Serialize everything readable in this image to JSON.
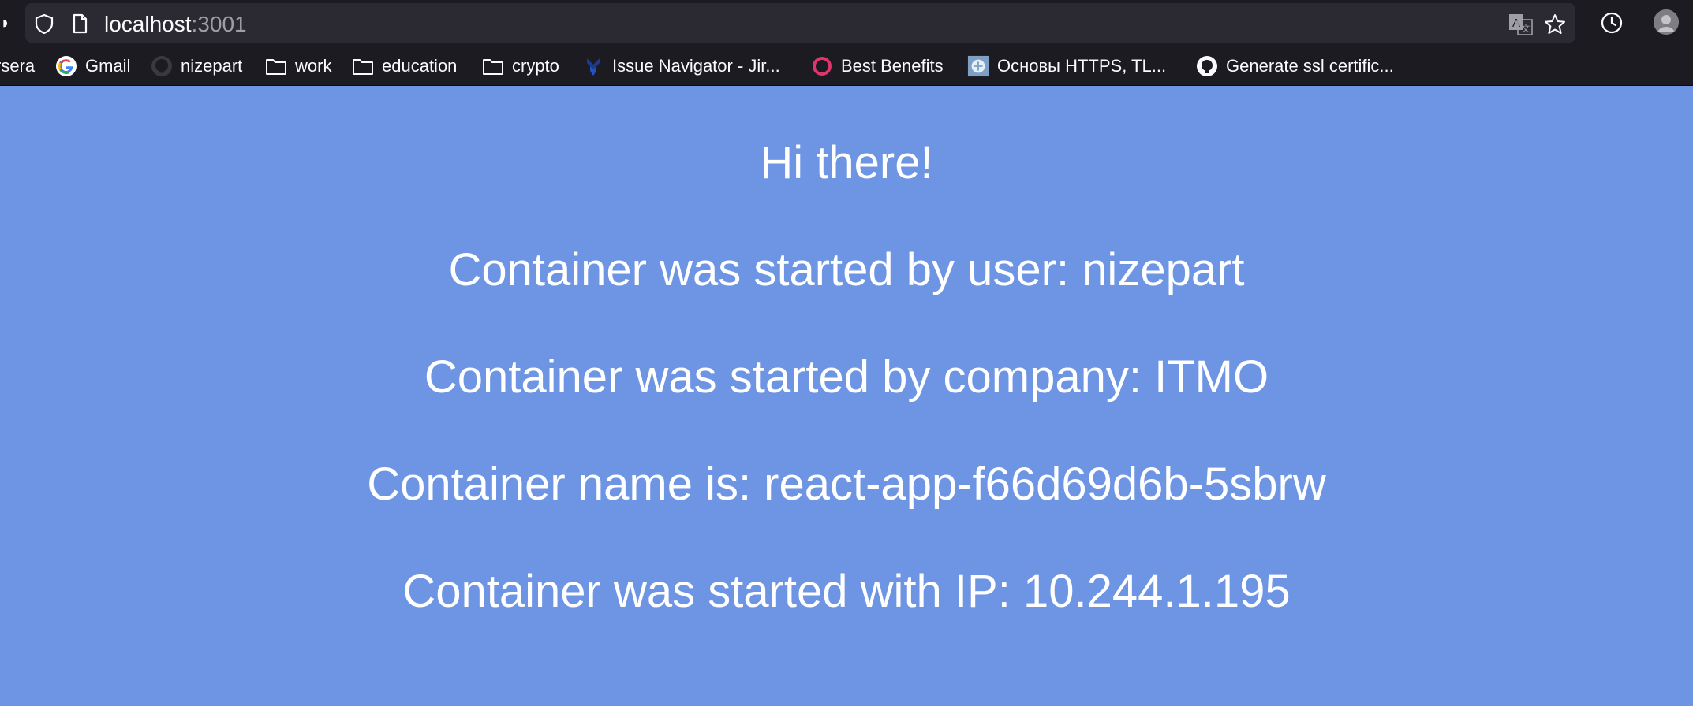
{
  "browser": {
    "url_host": "localhost",
    "url_port": ":3001",
    "left_edge_glyph": "◗"
  },
  "bookmarks": [
    {
      "label": "rsera",
      "icon": "none"
    },
    {
      "label": "Gmail",
      "icon": "google-icon"
    },
    {
      "label": "nizepart",
      "icon": "github-icon"
    },
    {
      "label": "work",
      "icon": "folder-icon"
    },
    {
      "label": "education",
      "icon": "folder-icon"
    },
    {
      "label": "crypto",
      "icon": "folder-icon"
    },
    {
      "label": "Issue Navigator - Jir...",
      "icon": "jira-icon"
    },
    {
      "label": "Best Benefits",
      "icon": "benefits-icon"
    },
    {
      "label": "Основы HTTPS, TL...",
      "icon": "site-icon"
    },
    {
      "label": "Generate ssl certific...",
      "icon": "github-icon"
    }
  ],
  "content": {
    "greeting": "Hi there!",
    "user_line": "Container was started by user: nizepart",
    "company_line": "Container was started by company: ITMO",
    "name_line": "Container name is: react-app-f66d69d6b-5sbrw",
    "ip_line": "Container was started with IP: 10.244.1.195"
  },
  "colors": {
    "page_background": "#6d95e3",
    "chrome_background": "#1c1b22",
    "text": "#ffffff"
  }
}
